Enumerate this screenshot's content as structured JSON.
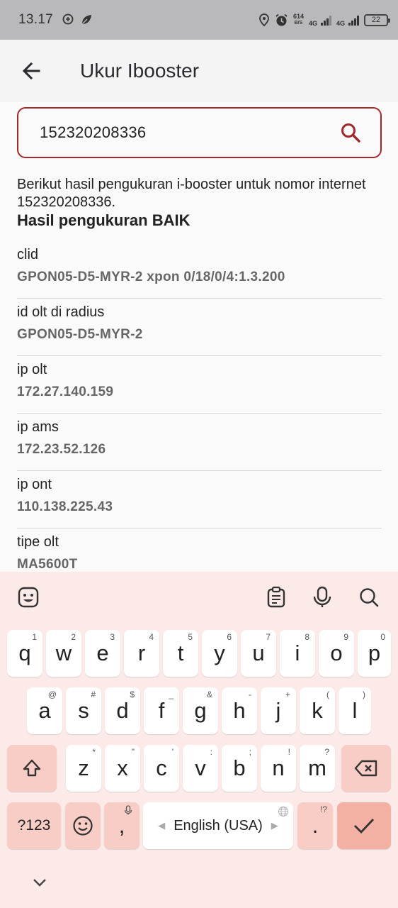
{
  "status_bar": {
    "time": "13.17",
    "net_speed_value": "614",
    "net_speed_unit": "B/S",
    "net1_label": "4G",
    "net2_label": "4G",
    "battery": "22"
  },
  "app_bar": {
    "title": "Ukur Ibooster"
  },
  "search": {
    "value": "152320208336"
  },
  "result": {
    "intro": "Berikut hasil pengukuran i-booster untuk nomor internet 152320208336.",
    "status": "Hasil pengukuran BAIK"
  },
  "fields": [
    {
      "label": "clid",
      "value": "GPON05-D5-MYR-2 xpon 0/18/0/4:1.3.200"
    },
    {
      "label": "id olt di radius",
      "value": "GPON05-D5-MYR-2"
    },
    {
      "label": "ip olt",
      "value": "172.27.140.159"
    },
    {
      "label": "ip ams",
      "value": "172.23.52.126"
    },
    {
      "label": "ip ont",
      "value": "110.138.225.43"
    },
    {
      "label": "tipe olt",
      "value": "MA5600T"
    }
  ],
  "keyboard": {
    "row1": [
      {
        "k": "q",
        "h": "1"
      },
      {
        "k": "w",
        "h": "2"
      },
      {
        "k": "e",
        "h": "3"
      },
      {
        "k": "r",
        "h": "4"
      },
      {
        "k": "t",
        "h": "5"
      },
      {
        "k": "y",
        "h": "6"
      },
      {
        "k": "u",
        "h": "7"
      },
      {
        "k": "i",
        "h": "8"
      },
      {
        "k": "o",
        "h": "9"
      },
      {
        "k": "p",
        "h": "0"
      }
    ],
    "row2": [
      {
        "k": "a",
        "h": "@"
      },
      {
        "k": "s",
        "h": "#"
      },
      {
        "k": "d",
        "h": "$"
      },
      {
        "k": "f",
        "h": "_"
      },
      {
        "k": "g",
        "h": "&"
      },
      {
        "k": "h",
        "h": "-"
      },
      {
        "k": "j",
        "h": "+"
      },
      {
        "k": "k",
        "h": "("
      },
      {
        "k": "l",
        "h": ")"
      }
    ],
    "row3": [
      {
        "k": "z",
        "h": "*"
      },
      {
        "k": "x",
        "h": "\""
      },
      {
        "k": "c",
        "h": "'"
      },
      {
        "k": "v",
        "h": ":"
      },
      {
        "k": "b",
        "h": ";"
      },
      {
        "k": "n",
        "h": "!"
      },
      {
        "k": "m",
        "h": "?"
      }
    ],
    "sym_label": "?123",
    "comma": ",",
    "space_label": "English (USA)",
    "period": ".",
    "period_hint": "!?"
  }
}
